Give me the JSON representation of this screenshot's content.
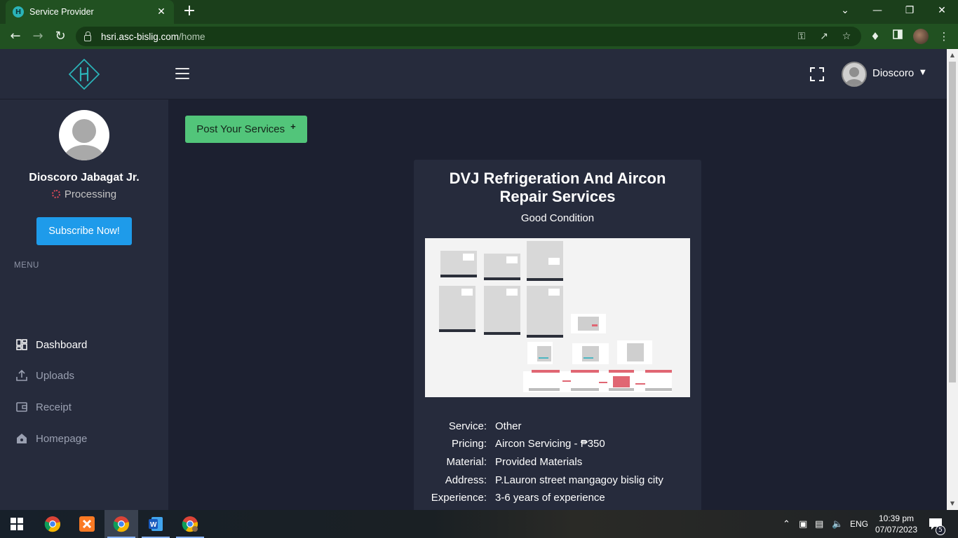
{
  "browser": {
    "tab_title": "Service Provider",
    "tab_close": "✕",
    "new_tab": "+",
    "url_host": "hsri.asc-bislig.com",
    "url_path": "/home",
    "win_minimize": "—",
    "win_restore": "❐",
    "win_close": "✕",
    "tab_search": "⌄"
  },
  "header": {
    "user_name": "Dioscoro"
  },
  "sidebar": {
    "profile_name": "Dioscoro Jabagat Jr.",
    "status": "Processing",
    "subscribe_label": "Subscribe Now!",
    "menu_heading": "MENU",
    "items": [
      {
        "label": "Dashboard",
        "icon": "dashboard-icon",
        "active": true
      },
      {
        "label": "Uploads",
        "icon": "upload-icon",
        "active": false
      },
      {
        "label": "Receipt",
        "icon": "receipt-icon",
        "active": false
      },
      {
        "label": "Homepage",
        "icon": "home-icon",
        "active": false
      }
    ]
  },
  "main": {
    "post_button_label": "Post Your Services",
    "card": {
      "title_line1": "DVJ Refrigeration And Aircon",
      "title_line2": "Repair Services",
      "subtitle": "Good Condition",
      "details": [
        {
          "label": "Service:",
          "value": "Other"
        },
        {
          "label": "Pricing:",
          "value": "Aircon Servicing - ₱350"
        },
        {
          "label": "Material:",
          "value": "Provided Materials"
        },
        {
          "label": "Address:",
          "value": "P.Lauron street mangagoy bislig city"
        },
        {
          "label": "Experience:",
          "value": "3-6 years of experience"
        }
      ]
    }
  },
  "taskbar": {
    "language": "ENG",
    "time": "10:39 pm",
    "date": "07/07/2023",
    "notification_count": "5"
  },
  "colors": {
    "browser_frame": "#215121",
    "page_bg": "#1c2030",
    "panel_bg": "#262b3c",
    "subscribe_blue": "#1e9bea",
    "post_green": "#52c57a",
    "logo_teal": "#2bb3b8"
  }
}
